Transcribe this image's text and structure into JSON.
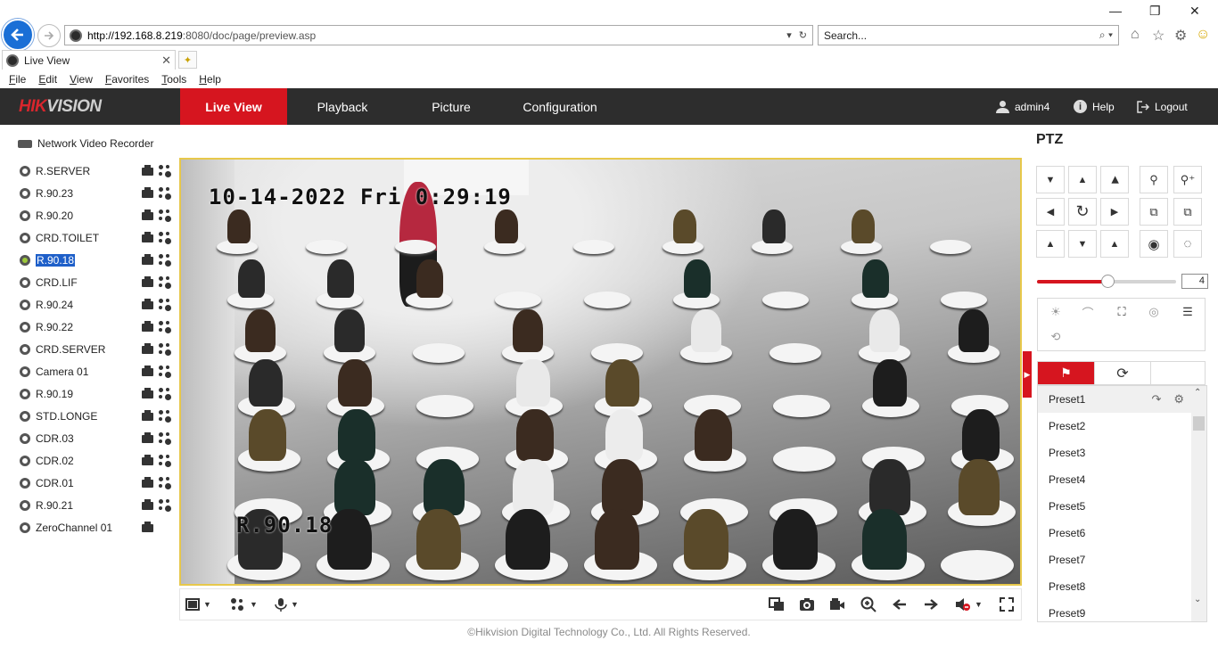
{
  "browser": {
    "url_host": "http://192.168.8.219",
    "url_rest": ":8080/doc/page/preview.asp",
    "search_placeholder": "Search...",
    "tab_title": "Live View",
    "menu": [
      "File",
      "Edit",
      "View",
      "Favorites",
      "Tools",
      "Help"
    ]
  },
  "header": {
    "logo_hik": "HIK",
    "logo_vision": "VISION",
    "nav": {
      "live_view": "Live View",
      "playback": "Playback",
      "picture": "Picture",
      "configuration": "Configuration"
    },
    "user": "admin4",
    "help": "Help",
    "logout": "Logout"
  },
  "tree": {
    "root": "Network Video Recorder",
    "cameras": [
      {
        "label": "R.SERVER",
        "ptz": true
      },
      {
        "label": "R.90.23",
        "ptz": true
      },
      {
        "label": "R.90.20",
        "ptz": true
      },
      {
        "label": "CRD.TOILET",
        "ptz": true
      },
      {
        "label": "R.90.18",
        "ptz": true,
        "selected": true
      },
      {
        "label": "CRD.LIF",
        "ptz": true
      },
      {
        "label": "R.90.24",
        "ptz": true
      },
      {
        "label": "R.90.22",
        "ptz": true
      },
      {
        "label": "CRD.SERVER",
        "ptz": true
      },
      {
        "label": "Camera 01",
        "ptz": true
      },
      {
        "label": "R.90.19",
        "ptz": true
      },
      {
        "label": "STD.LONGE",
        "ptz": true
      },
      {
        "label": "CDR.03",
        "ptz": true
      },
      {
        "label": "CDR.02",
        "ptz": true
      },
      {
        "label": "CDR.01",
        "ptz": true
      },
      {
        "label": "R.90.21",
        "ptz": true
      },
      {
        "label": "ZeroChannel 01",
        "ptz": false
      }
    ]
  },
  "video": {
    "osd_time": "10-14-2022 Fri 0:29:19",
    "osd_camera": "R.90.18"
  },
  "ptz": {
    "title": "PTZ",
    "speed": "4",
    "speed_fraction": 0.5,
    "presets": [
      "Preset1",
      "Preset2",
      "Preset3",
      "Preset4",
      "Preset5",
      "Preset6",
      "Preset7",
      "Preset8",
      "Preset9"
    ]
  },
  "footer": "©Hikvision Digital Technology Co., Ltd. All Rights Reserved.",
  "colors": {
    "brand_red": "#d6151f",
    "header_bg": "#2d2d2d",
    "selected_blue": "#1e5fc9",
    "video_border": "#e7c84b"
  }
}
